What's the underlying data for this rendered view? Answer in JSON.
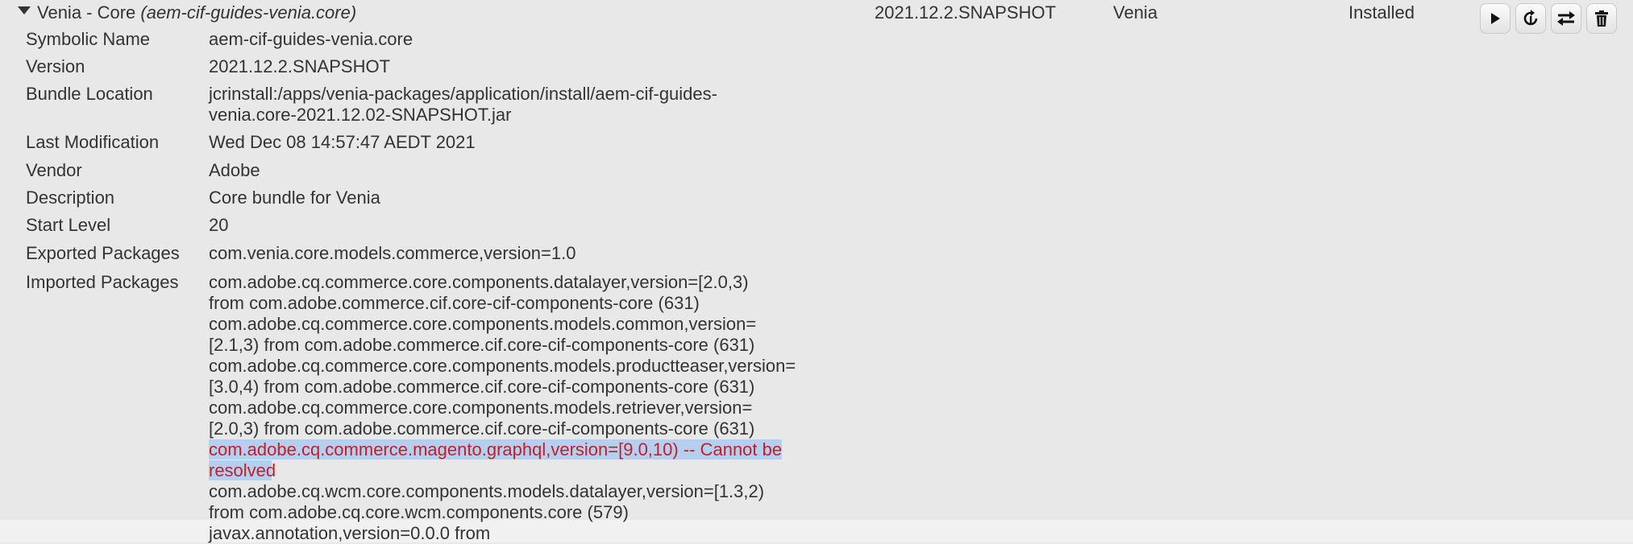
{
  "bundle": {
    "name": "Venia - Core",
    "symbolic_paren": "(aem-cif-guides-venia.core)",
    "version": "2021.12.2.SNAPSHOT",
    "category": "Venia",
    "state": "Installed",
    "actions": [
      {
        "icon": "play-icon"
      },
      {
        "icon": "refresh-icon"
      },
      {
        "icon": "update-icon"
      },
      {
        "icon": "trash-icon"
      }
    ]
  },
  "details": {
    "symbolic_name": {
      "label": "Symbolic Name",
      "value": "aem-cif-guides-venia.core"
    },
    "version": {
      "label": "Version",
      "value": "2021.12.2.SNAPSHOT"
    },
    "bundle_location": {
      "label": "Bundle Location",
      "lines": [
        "jcrinstall:/apps/venia-packages/application/install/aem-cif-guides-",
        "venia.core-2021.12.02-SNAPSHOT.jar"
      ]
    },
    "last_modification": {
      "label": "Last Modification",
      "value": "Wed Dec 08 14:57:47 AEDT 2021"
    },
    "vendor": {
      "label": "Vendor",
      "value": "Adobe"
    },
    "description": {
      "label": "Description",
      "value": "Core bundle for Venia"
    },
    "start_level": {
      "label": "Start Level",
      "value": "20"
    },
    "exported_packages": {
      "label": "Exported Packages",
      "value": "com.venia.core.models.commerce,version=1.0"
    },
    "imported_packages": {
      "label": "Imported Packages",
      "lines": [
        "com.adobe.cq.commerce.core.components.datalayer,version=[2.0,3)",
        "from com.adobe.commerce.cif.core-cif-components-core (631)",
        "com.adobe.cq.commerce.core.components.models.common,version=",
        "[2.1,3) from com.adobe.commerce.cif.core-cif-components-core (631)",
        "com.adobe.cq.commerce.core.components.models.productteaser,version=",
        "[3.0,4) from com.adobe.commerce.cif.core-cif-components-core (631)",
        "com.adobe.cq.commerce.core.components.models.retriever,version=",
        "[2.0,3) from com.adobe.commerce.cif.core-cif-components-core (631)"
      ],
      "error_lines": [
        "com.adobe.cq.commerce.magento.graphql,version=[9.0,10) -- Cannot be ",
        "resolved"
      ],
      "trailing_lines": [
        "com.adobe.cq.wcm.core.components.models.datalayer,version=[1.3,2)",
        "from com.adobe.cq.core.wcm.components.core (579)",
        "javax.annotation,version=0.0.0 from"
      ]
    }
  }
}
